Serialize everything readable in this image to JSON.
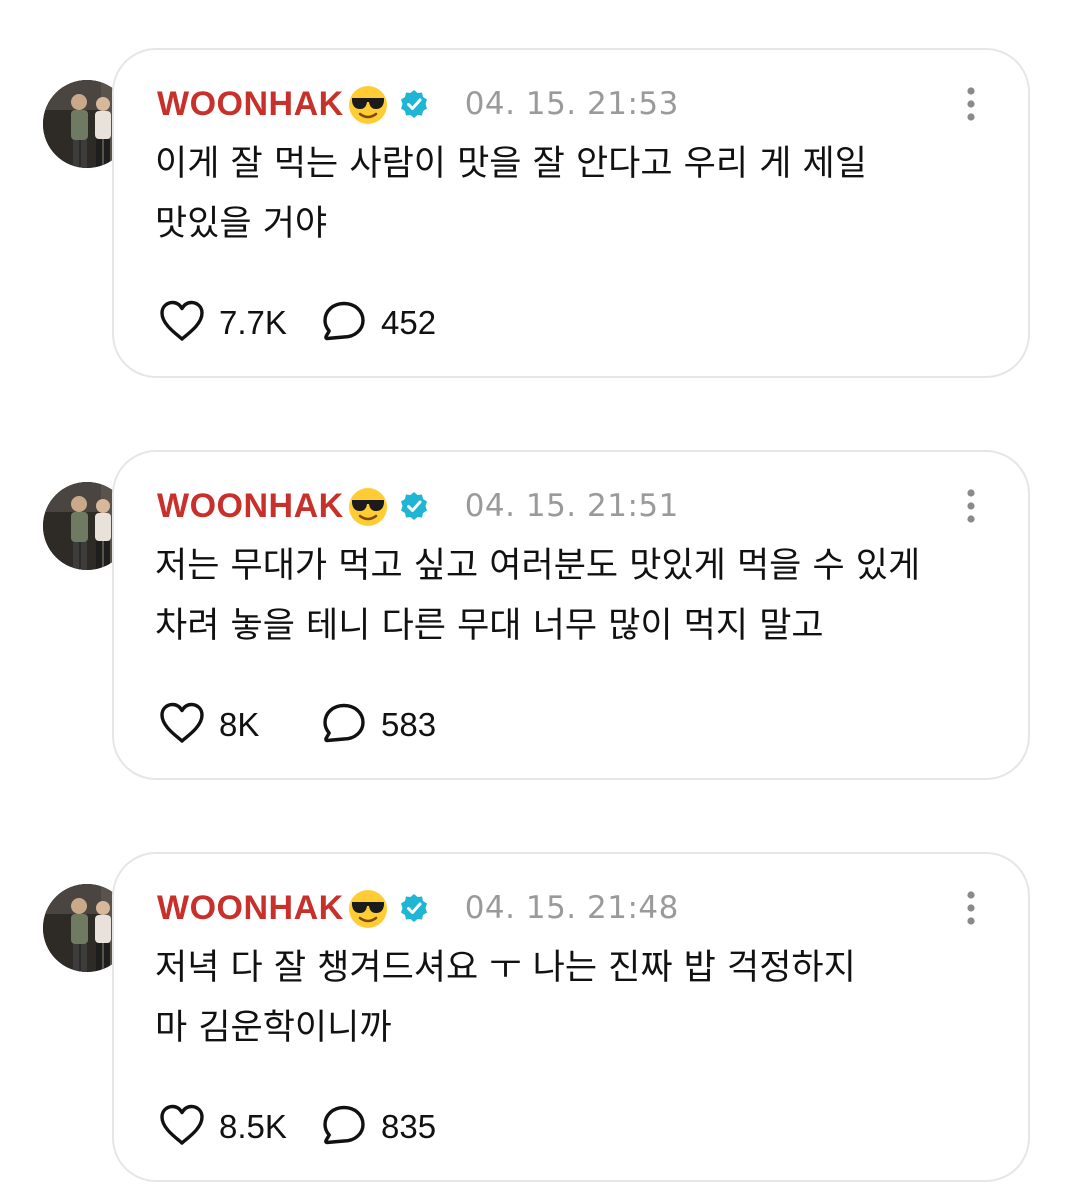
{
  "accent": {
    "username_color": "#c8312b",
    "verified_color": "#1fb5d4",
    "timestamp_color": "#9a9a9a"
  },
  "icons": {
    "emoji": "smiling-face-with-sunglasses-icon",
    "verified": "verified-badge-icon",
    "more": "vertical-ellipsis-icon",
    "like": "heart-outline-icon",
    "comment": "speech-bubble-outline-icon"
  },
  "posts": [
    {
      "username": "WOONHAK",
      "timestamp": "04. 15. 21:53",
      "lines": [
        "이게 잘 먹는 사람이 맛을 잘 안다고 우리 게 제일",
        "맛있을 거야"
      ],
      "likes": "7.7K",
      "comments": "452"
    },
    {
      "username": "WOONHAK",
      "timestamp": "04. 15. 21:51",
      "lines": [
        "저는 무대가 먹고 싶고 여러분도 맛있게 먹을 수 있게",
        "차려 놓을 테니 다른 무대 너무 많이 먹지 말고"
      ],
      "likes": "8K",
      "comments": "583"
    },
    {
      "username": "WOONHAK",
      "timestamp": "04. 15. 21:48",
      "lines": [
        "저녁 다 잘 챙겨드셔요 ㅜ 나는 진짜 밥 걱정하지",
        "마 김운학이니까"
      ],
      "likes": "8.5K",
      "comments": "835"
    }
  ]
}
